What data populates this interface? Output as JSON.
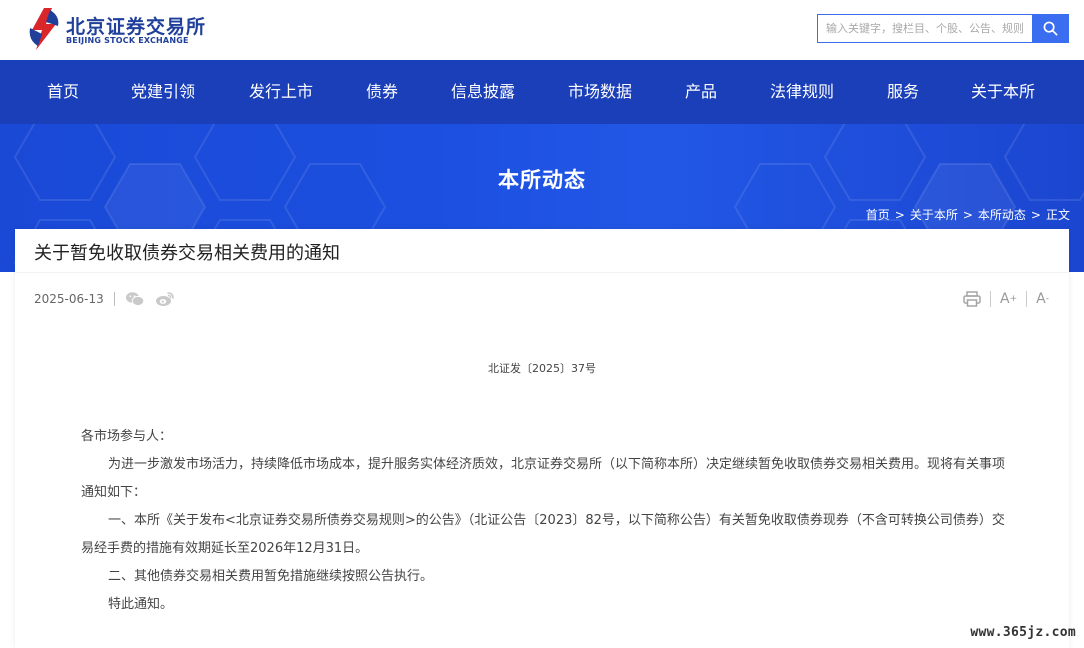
{
  "header": {
    "logo_cn": "北京证券交易所",
    "logo_en": "BEIJING STOCK EXCHANGE",
    "search_placeholder": "输入关键字，搜栏目、个股、公告、规则",
    "brand_color": "#1a3fb8",
    "accent_color": "#3a6df0"
  },
  "nav": {
    "items": [
      {
        "label": "首页"
      },
      {
        "label": "党建引领"
      },
      {
        "label": "发行上市"
      },
      {
        "label": "债券"
      },
      {
        "label": "信息披露"
      },
      {
        "label": "市场数据"
      },
      {
        "label": "产品"
      },
      {
        "label": "法律规则"
      },
      {
        "label": "服务"
      },
      {
        "label": "关于本所"
      }
    ]
  },
  "banner": {
    "title": "本所动态",
    "breadcrumb": [
      "首页",
      "关于本所",
      "本所动态",
      "正文"
    ],
    "separator": ">"
  },
  "article": {
    "title": "关于暂免收取债券交易相关费用的通知",
    "date": "2025-06-13",
    "share_icons": [
      "wechat-icon",
      "weibo-icon"
    ],
    "tools": {
      "print": "print-icon",
      "font_larger": "A",
      "font_smaller": "A"
    },
    "doc_number": "北证发〔2025〕37号",
    "salutation": "各市场参与人：",
    "paragraphs": [
      "为进一步激发市场活力，持续降低市场成本，提升服务实体经济质效，北京证券交易所（以下简称本所）决定继续暂免收取债券交易相关费用。现将有关事项通知如下：",
      "一、本所《关于发布<北京证券交易所债券交易规则>的公告》（北证公告〔2023〕82号，以下简称公告）有关暂免收取债券现券（不含可转换公司债券）交易经手费的措施有效期延长至2026年12月31日。",
      "二、其他债券交易相关费用暂免措施继续按照公告执行。",
      "特此通知。"
    ]
  },
  "watermark": "www.365jz.com"
}
